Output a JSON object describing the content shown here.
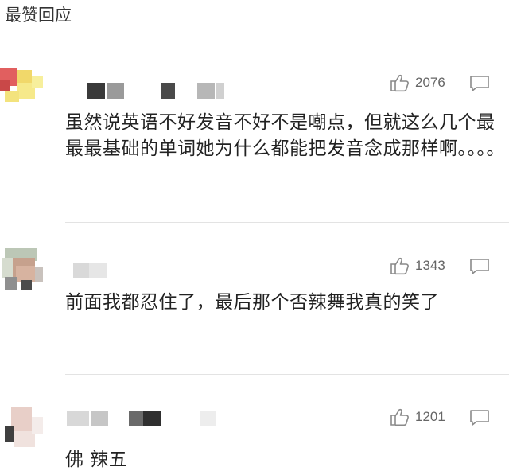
{
  "section_title": "最赞回应",
  "comments": [
    {
      "like_count": "2076",
      "text": "虽然说英语不好发音不好不是嘲点，但就这么几个最最最基础的单词她为什么都能把发音念成那样啊。。。。"
    },
    {
      "like_count": "1343",
      "text": "前面我都忍住了，最后那个否辣舞我真的笑了"
    },
    {
      "like_count": "1201",
      "text": "佛 辣五"
    }
  ],
  "icons": {
    "like": "thumbs-up-icon",
    "reply": "comment-bubble-icon"
  },
  "colors": {
    "icon_gray": "#8a8a8a",
    "text": "#222222",
    "count": "#666666",
    "divider": "#e3e3e3"
  }
}
